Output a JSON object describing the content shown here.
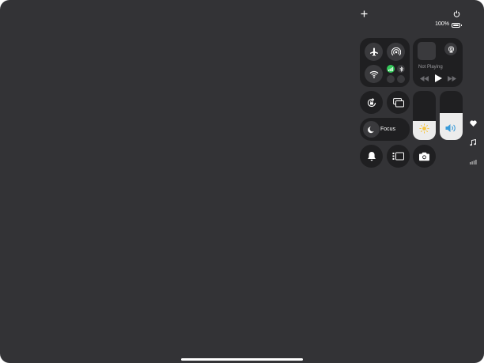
{
  "top_bar": {
    "add_icon": "plus-icon",
    "power_icon": "power-icon",
    "battery_percent": "100%",
    "battery_level_percent": 100
  },
  "connectivity": {
    "airplane_icon": "airplane-icon",
    "airdrop_icon": "airdrop-icon",
    "wifi_icon": "wifi-icon",
    "cellular_icon": "cellular-icon",
    "bluetooth_icon": "bluetooth-icon",
    "active_color": "#34c759"
  },
  "now_playing": {
    "status": "Not Playing",
    "airplay_icon": "airplay-icon",
    "rewind_icon": "rewind-icon",
    "play_icon": "play-icon",
    "forward_icon": "forward-icon"
  },
  "controls": {
    "rotation_lock_icon": "rotation-lock-icon",
    "screen_mirroring_icon": "screen-mirroring-icon",
    "focus_label": "Focus",
    "focus_icon": "moon-icon",
    "bell_icon": "bell-icon",
    "stage_manager_icon": "stage-manager-icon",
    "camera_icon": "camera-icon"
  },
  "sliders": {
    "brightness_level": 0.38,
    "brightness_icon": "sun-icon",
    "brightness_color": "#f5c542",
    "volume_level": 0.55,
    "volume_icon": "speaker-icon",
    "volume_color": "#3a9bd9"
  },
  "side_icons": [
    "heart-icon",
    "music-note-icon",
    "signal-icon"
  ]
}
